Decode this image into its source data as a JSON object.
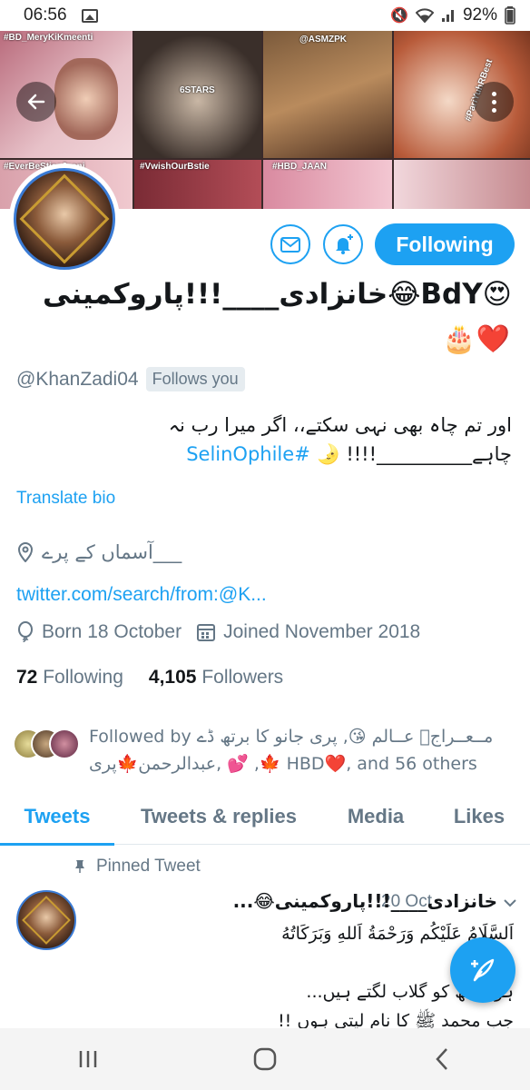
{
  "status_bar": {
    "time": "06:56",
    "battery": "92%"
  },
  "banner": {
    "tiles": [
      {
        "text": "#BD_MeryKiKmeenti",
        "color": "#c98f98"
      },
      {
        "text": "6STARS",
        "color": "#4d4a47"
      },
      {
        "text": "@ASMZPK",
        "color": "#6d4a2e"
      },
      {
        "text": "#PariYuhRBest",
        "color": "#a85b3a"
      },
      {
        "text": "#EverBeStieeJaani",
        "color": "#d29aa4"
      },
      {
        "text": "#VwishOurBstie",
        "color": "#8a2b3a"
      },
      {
        "text": "#HBD_JAAN",
        "color": "#b04e6a"
      }
    ]
  },
  "profile": {
    "name": "خانزادی____!!!پاروکمینی😂BdY😍",
    "name_emoji": "🎂❤️",
    "handle": "@KhanZadi04",
    "follows_you": "Follows you",
    "bio_hashtag": "#SelinOphile",
    "bio_text": "اور تم چاہ بھی نہی سکتے،، اگر میرا رب نہ چاہے__________!!!!",
    "bio_moon": "🌛",
    "translate": "Translate bio",
    "location": "آسماں کے پرے___",
    "link": "twitter.com/search/from:@K...",
    "born": "Born 18 October",
    "joined": "Joined November 2018",
    "following_count": "72",
    "following_label": "Following",
    "followers_count": "4,105",
    "followers_label": "Followers",
    "followed_by": "Followed by مــعــراجؔ عــالم 😘, پری جانو کا برتھ ڈے 🍁, 💕 ,عبدالرحمن🍁پری HBD❤️, and 56 others"
  },
  "buttons": {
    "following": "Following"
  },
  "tabs": [
    {
      "label": "Tweets",
      "active": true
    },
    {
      "label": "Tweets & replies",
      "active": false
    },
    {
      "label": "Media",
      "active": false
    },
    {
      "label": "Likes",
      "active": false
    }
  ],
  "tweet": {
    "pinned_label": "Pinned Tweet",
    "author": "خانزادی____!!!پاروکمینی😂...",
    "date": "20 Oct",
    "body_line1": "اَلسَّلَامُ عَلَيْكُم وَرَحْمَةُ اَللهِ وَبَرَكَاتُهُ",
    "body_line2": "ہوں جھ کو گلاب لگتے ہیں...",
    "body_line3": "جب محمد ﷺ کا نام لیتی ہوں !!"
  },
  "colors": {
    "accent": "#1da1f2",
    "muted": "#657786",
    "text": "#14171a"
  }
}
